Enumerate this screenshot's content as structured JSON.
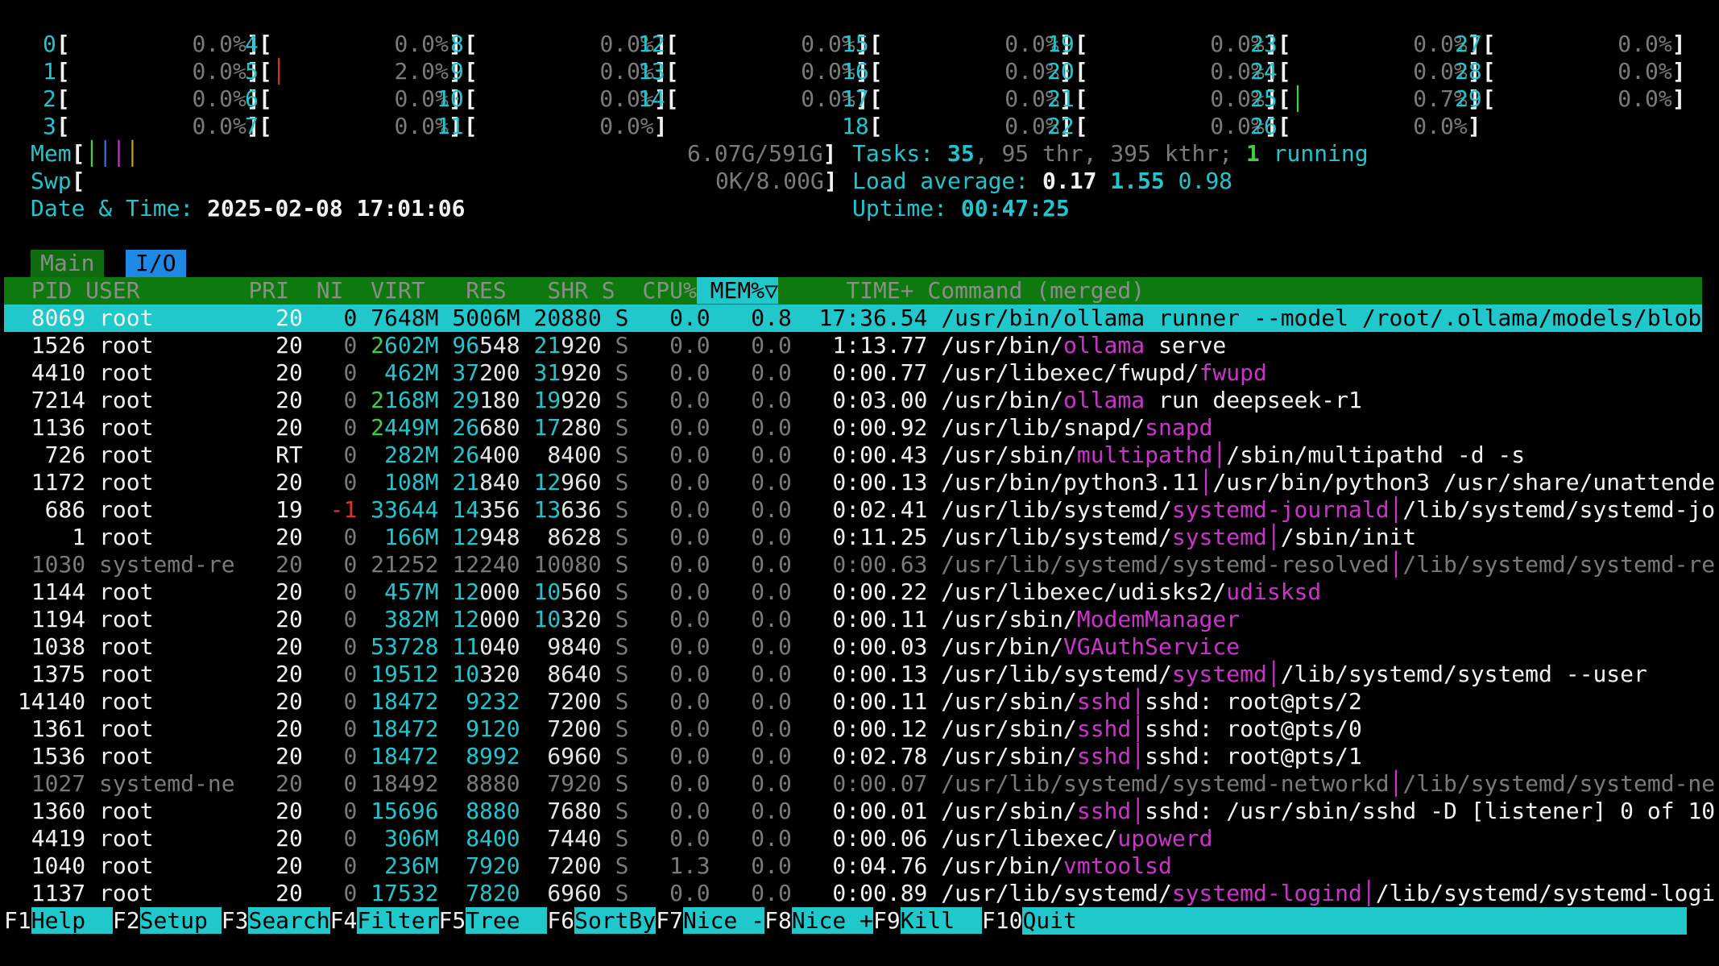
{
  "cpu_meters": [
    {
      "id": "0",
      "value": "0.0%"
    },
    {
      "id": "1",
      "value": "0.0%"
    },
    {
      "id": "2",
      "value": "0.0%"
    },
    {
      "id": "3",
      "value": "0.0%"
    },
    {
      "id": "4",
      "value": "0.0%"
    },
    {
      "id": "5",
      "value": "2.0%"
    },
    {
      "id": "6",
      "value": "0.0%"
    },
    {
      "id": "7",
      "value": "0.0%"
    },
    {
      "id": "8",
      "value": "0.0%"
    },
    {
      "id": "9",
      "value": "0.0%"
    },
    {
      "id": "10",
      "value": "0.0%"
    },
    {
      "id": "11",
      "value": "0.0%"
    },
    {
      "id": "12",
      "value": "0.0%"
    },
    {
      "id": "13",
      "value": "0.0%"
    },
    {
      "id": "14",
      "value": "0.0%"
    },
    {
      "id": "15",
      "value": "0.0%"
    },
    {
      "id": "16",
      "value": "0.0%"
    },
    {
      "id": "17",
      "value": "0.0%"
    },
    {
      "id": "18",
      "value": "0.0%"
    },
    {
      "id": "19",
      "value": "0.0%"
    },
    {
      "id": "20",
      "value": "0.0%"
    },
    {
      "id": "21",
      "value": "0.0%"
    },
    {
      "id": "22",
      "value": "0.0%"
    },
    {
      "id": "23",
      "value": "0.0%"
    },
    {
      "id": "24",
      "value": "0.0%"
    },
    {
      "id": "25",
      "value": "0.7%"
    },
    {
      "id": "26",
      "value": "0.0%"
    },
    {
      "id": "27",
      "value": "0.0%"
    },
    {
      "id": "28",
      "value": "0.0%"
    },
    {
      "id": "29",
      "value": "0.0%"
    }
  ],
  "meters": {
    "mem_label": "Mem",
    "mem_value": "6.07G/591G",
    "swp_label": "Swp",
    "swp_value": "0K/8.00G",
    "datetime_label": "Date & Time:",
    "datetime_value": "2025-02-08 17:01:06"
  },
  "tasks": {
    "label": "Tasks:",
    "count": "35",
    "thr": "95 thr,",
    "kthr": "395 kthr;",
    "running": "1",
    "running_label": "running"
  },
  "load": {
    "label": "Load average:",
    "l1": "0.17",
    "l5": "1.55",
    "l15": "0.98"
  },
  "uptime": {
    "label": "Uptime:",
    "value": "00:47:25"
  },
  "tabs": {
    "main": "Main",
    "io": "I/O"
  },
  "columns": [
    "PID",
    "USER",
    "PRI",
    "NI",
    "VIRT",
    "RES",
    "SHR",
    "S",
    "CPU%",
    "MEM%▽",
    "TIME+",
    "Command (merged)"
  ],
  "processes": [
    {
      "pid": "8069",
      "user": "root",
      "pri": "20",
      "ni": "0",
      "virt": "7648M",
      "res": "5006M",
      "shr": "20880",
      "s": "S",
      "cpu": "0.0",
      "mem": "0.8",
      "time": "17:36.54",
      "cmd": "/usr/bin/ollama runner --model /root/.ollama/models/blobs",
      "selected": true
    },
    {
      "pid": "1526",
      "user": "root",
      "pri": "20",
      "ni": "0",
      "virt": "2602M",
      "res": "96548",
      "shr": "21920",
      "s": "S",
      "cpu": "0.0",
      "mem": "0.0",
      "time": "1:13.77",
      "cmd_pre": "/usr/bin/",
      "cmd_hl": "ollama",
      "cmd_post": " serve"
    },
    {
      "pid": "4410",
      "user": "root",
      "pri": "20",
      "ni": "0",
      "virt": "462M",
      "res": "37200",
      "shr": "31920",
      "s": "S",
      "cpu": "0.0",
      "mem": "0.0",
      "time": "0:00.77",
      "cmd_pre": "/usr/libexec/fwupd/",
      "cmd_hl": "fwupd",
      "cmd_post": ""
    },
    {
      "pid": "7214",
      "user": "root",
      "pri": "20",
      "ni": "0",
      "virt": "2168M",
      "res": "29180",
      "shr": "19920",
      "s": "S",
      "cpu": "0.0",
      "mem": "0.0",
      "time": "0:03.00",
      "cmd_pre": "/usr/bin/",
      "cmd_hl": "ollama",
      "cmd_post": " run deepseek-r1"
    },
    {
      "pid": "1136",
      "user": "root",
      "pri": "20",
      "ni": "0",
      "virt": "2449M",
      "res": "26680",
      "shr": "17280",
      "s": "S",
      "cpu": "0.0",
      "mem": "0.0",
      "time": "0:00.92",
      "cmd_pre": "/usr/lib/snapd/",
      "cmd_hl": "snapd",
      "cmd_post": ""
    },
    {
      "pid": "726",
      "user": "root",
      "pri": "RT",
      "ni": "0",
      "virt": "282M",
      "res": "26400",
      "shr": "8400",
      "s": "S",
      "cpu": "0.0",
      "mem": "0.0",
      "time": "0:00.43",
      "cmd_pre": "/usr/sbin/",
      "cmd_hl": "multipathd",
      "cmd_post": "│/sbin/multipathd -d -s"
    },
    {
      "pid": "1172",
      "user": "root",
      "pri": "20",
      "ni": "0",
      "virt": "108M",
      "res": "21840",
      "shr": "12960",
      "s": "S",
      "cpu": "0.0",
      "mem": "0.0",
      "time": "0:00.13",
      "cmd_pre": "/usr/bin/python3.11",
      "cmd_hl": "",
      "cmd_post": "│/usr/bin/python3 /usr/share/unattende"
    },
    {
      "pid": "686",
      "user": "root",
      "pri": "19",
      "ni": "-1",
      "virt": "33644",
      "res": "14356",
      "shr": "13636",
      "s": "S",
      "cpu": "0.0",
      "mem": "0.0",
      "time": "0:02.41",
      "cmd_pre": "/usr/lib/systemd/",
      "cmd_hl": "systemd-journald",
      "cmd_post": "│/lib/systemd/systemd-jo"
    },
    {
      "pid": "1",
      "user": "root",
      "pri": "20",
      "ni": "0",
      "virt": "166M",
      "res": "12948",
      "shr": "8628",
      "s": "S",
      "cpu": "0.0",
      "mem": "0.0",
      "time": "0:11.25",
      "cmd_pre": "/usr/lib/systemd/",
      "cmd_hl": "systemd",
      "cmd_post": "│/sbin/init"
    },
    {
      "pid": "1030",
      "user": "systemd-re",
      "pri": "20",
      "ni": "0",
      "virt": "21252",
      "res": "12240",
      "shr": "10080",
      "s": "S",
      "cpu": "0.0",
      "mem": "0.0",
      "time": "0:00.63",
      "cmd_pre": "/usr/lib/systemd/systemd-resolved",
      "cmd_hl": "",
      "cmd_post": "│/lib/systemd/systemd-re",
      "dim": true
    },
    {
      "pid": "1144",
      "user": "root",
      "pri": "20",
      "ni": "0",
      "virt": "457M",
      "res": "12000",
      "shr": "10560",
      "s": "S",
      "cpu": "0.0",
      "mem": "0.0",
      "time": "0:00.22",
      "cmd_pre": "/usr/libexec/udisks2/",
      "cmd_hl": "udisksd",
      "cmd_post": ""
    },
    {
      "pid": "1194",
      "user": "root",
      "pri": "20",
      "ni": "0",
      "virt": "382M",
      "res": "12000",
      "shr": "10320",
      "s": "S",
      "cpu": "0.0",
      "mem": "0.0",
      "time": "0:00.11",
      "cmd_pre": "/usr/sbin/",
      "cmd_hl": "ModemManager",
      "cmd_post": ""
    },
    {
      "pid": "1038",
      "user": "root",
      "pri": "20",
      "ni": "0",
      "virt": "53728",
      "res": "11040",
      "shr": "9840",
      "s": "S",
      "cpu": "0.0",
      "mem": "0.0",
      "time": "0:00.03",
      "cmd_pre": "/usr/bin/",
      "cmd_hl": "VGAuthService",
      "cmd_post": ""
    },
    {
      "pid": "1375",
      "user": "root",
      "pri": "20",
      "ni": "0",
      "virt": "19512",
      "res": "10320",
      "shr": "8640",
      "s": "S",
      "cpu": "0.0",
      "mem": "0.0",
      "time": "0:00.13",
      "cmd_pre": "/usr/lib/systemd/",
      "cmd_hl": "systemd",
      "cmd_post": "│/lib/systemd/systemd --user"
    },
    {
      "pid": "14140",
      "user": "root",
      "pri": "20",
      "ni": "0",
      "virt": "18472",
      "res": "9232",
      "shr": "7200",
      "s": "S",
      "cpu": "0.0",
      "mem": "0.0",
      "time": "0:00.11",
      "cmd_pre": "/usr/sbin/",
      "cmd_hl": "sshd",
      "cmd_post": "│sshd: root@pts/2"
    },
    {
      "pid": "1361",
      "user": "root",
      "pri": "20",
      "ni": "0",
      "virt": "18472",
      "res": "9120",
      "shr": "7200",
      "s": "S",
      "cpu": "0.0",
      "mem": "0.0",
      "time": "0:00.12",
      "cmd_pre": "/usr/sbin/",
      "cmd_hl": "sshd",
      "cmd_post": "│sshd: root@pts/0"
    },
    {
      "pid": "1536",
      "user": "root",
      "pri": "20",
      "ni": "0",
      "virt": "18472",
      "res": "8992",
      "shr": "6960",
      "s": "S",
      "cpu": "0.0",
      "mem": "0.0",
      "time": "0:02.78",
      "cmd_pre": "/usr/sbin/",
      "cmd_hl": "sshd",
      "cmd_post": "│sshd: root@pts/1"
    },
    {
      "pid": "1027",
      "user": "systemd-ne",
      "pri": "20",
      "ni": "0",
      "virt": "18492",
      "res": "8880",
      "shr": "7920",
      "s": "S",
      "cpu": "0.0",
      "mem": "0.0",
      "time": "0:00.07",
      "cmd_pre": "/usr/lib/systemd/systemd-networkd",
      "cmd_hl": "",
      "cmd_post": "│/lib/systemd/systemd-ne",
      "dim": true
    },
    {
      "pid": "1360",
      "user": "root",
      "pri": "20",
      "ni": "0",
      "virt": "15696",
      "res": "8880",
      "shr": "7680",
      "s": "S",
      "cpu": "0.0",
      "mem": "0.0",
      "time": "0:00.01",
      "cmd_pre": "/usr/sbin/",
      "cmd_hl": "sshd",
      "cmd_post": "│sshd: /usr/sbin/sshd -D [listener] 0 of 10"
    },
    {
      "pid": "4419",
      "user": "root",
      "pri": "20",
      "ni": "0",
      "virt": "306M",
      "res": "8400",
      "shr": "7440",
      "s": "S",
      "cpu": "0.0",
      "mem": "0.0",
      "time": "0:00.06",
      "cmd_pre": "/usr/libexec/",
      "cmd_hl": "upowerd",
      "cmd_post": ""
    },
    {
      "pid": "1040",
      "user": "root",
      "pri": "20",
      "ni": "0",
      "virt": "236M",
      "res": "7920",
      "shr": "7200",
      "s": "S",
      "cpu": "1.3",
      "mem": "0.0",
      "time": "0:04.76",
      "cmd_pre": "/usr/bin/",
      "cmd_hl": "vmtoolsd",
      "cmd_post": ""
    },
    {
      "pid": "1137",
      "user": "root",
      "pri": "20",
      "ni": "0",
      "virt": "17532",
      "res": "7820",
      "shr": "6960",
      "s": "S",
      "cpu": "0.0",
      "mem": "0.0",
      "time": "0:00.89",
      "cmd_pre": "/usr/lib/systemd/",
      "cmd_hl": "systemd-logind",
      "cmd_post": "│/lib/systemd/systemd-logi"
    }
  ],
  "fkeys": [
    {
      "key": "F1",
      "label": "Help  "
    },
    {
      "key": "F2",
      "label": "Setup "
    },
    {
      "key": "F3",
      "label": "Search"
    },
    {
      "key": "F4",
      "label": "Filter"
    },
    {
      "key": "F5",
      "label": "Tree  "
    },
    {
      "key": "F6",
      "label": "SortBy"
    },
    {
      "key": "F7",
      "label": "Nice -"
    },
    {
      "key": "F8",
      "label": "Nice +"
    },
    {
      "key": "F9",
      "label": "Kill  "
    },
    {
      "key": "F10",
      "label": "Quit"
    }
  ],
  "colors": {
    "accent_cyan": "#20c8cc",
    "header_green": "#0e790e",
    "highlight_magenta": "#cc33cc",
    "tab_io_blue": "#1e88e5"
  }
}
